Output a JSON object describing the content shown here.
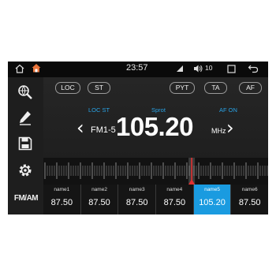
{
  "status_bar": {
    "time": "23:57",
    "volume": "10",
    "icons": [
      "home-outline-icon",
      "home-icon",
      "signal-icon",
      "volume-icon",
      "square-icon",
      "back-icon"
    ]
  },
  "sidebar": {
    "icons": [
      "search-globe-icon",
      "pen-icon",
      "save-icon",
      "gear-icon"
    ],
    "fm_am_label": "FM/AM"
  },
  "toggles": {
    "loc": "LOC",
    "st": "ST",
    "pty": "PYT",
    "ta": "TA",
    "af": "AF"
  },
  "radio": {
    "loc_st": "LOC  ST",
    "sprot": "Sprot",
    "af_on": "AF ON",
    "band": "FM1-5",
    "frequency": "105.20",
    "unit": "MHz",
    "tuner_position": 0.66
  },
  "presets": [
    {
      "name": "name1",
      "freq": "87.50"
    },
    {
      "name": "name2",
      "freq": "87.50"
    },
    {
      "name": "name3",
      "freq": "87.50"
    },
    {
      "name": "name4",
      "freq": "87.50"
    },
    {
      "name": "name5",
      "freq": "105.20",
      "active": true
    },
    {
      "name": "name6",
      "freq": "87.50"
    }
  ],
  "colors": {
    "accent": "#1a9be0",
    "info_text": "#29a3e6",
    "needle": "#e23030",
    "home_icon": "#e8733a"
  }
}
